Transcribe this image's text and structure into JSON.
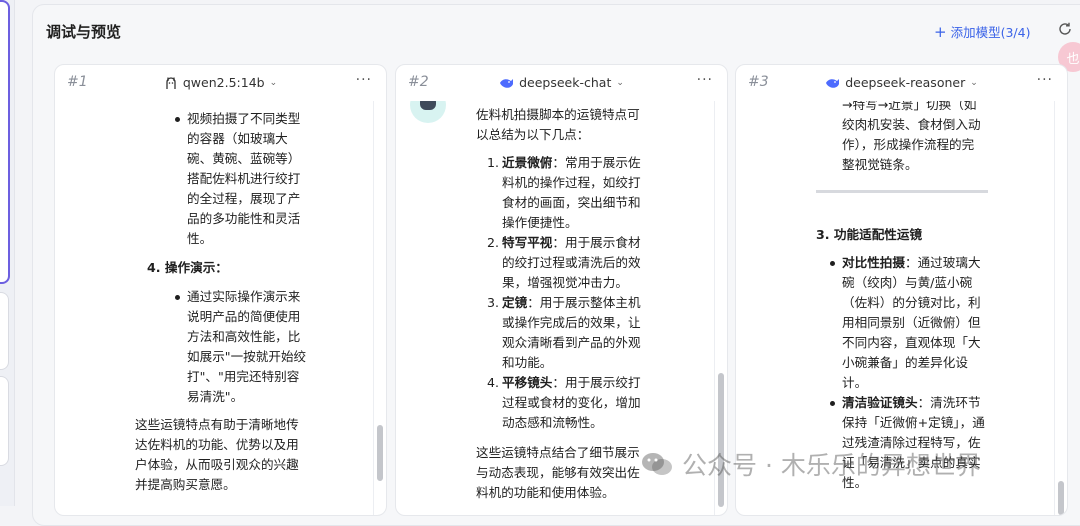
{
  "panel": {
    "title": "调试与预览",
    "add_model_label": "添加模型(3/4)"
  },
  "fab_label": "也",
  "columns": [
    {
      "index": "#1",
      "model": "qwen2.5:14b",
      "lines": [
        "视频拍摄了不同类型",
        "的容器（如玻璃大",
        "碗、黄碗、蓝碗等）",
        "搭配佐料机进行绞打",
        "的全过程，展现了产",
        "品的多功能性和灵活",
        "性。",
        "4. 操作演示：",
        "通过实际操作演示来",
        "说明产品的简便使用",
        "方法和高效性能，比",
        "如展示\"一按就开始绞",
        "打\"、\"用完还特别容",
        "易清洗\"。",
        "这些运镜特点有助于清晰地传",
        "达佐料机的功能、优势以及用",
        "户体验，从而吸引观众的兴趣",
        "并提高购买意愿。"
      ]
    },
    {
      "index": "#2",
      "model": "deepseek-chat",
      "lines": [
        "佐料机拍摄脚本的运镜特点可",
        "以总结为以下几点：",
        "1.",
        "近景微俯",
        "：常用于展示佐",
        "料机的操作过程，如绞打",
        "食材的画面，突出细节和",
        "操作便捷性。",
        "2.",
        "特写平视",
        "：用于展示食材",
        "的绞打过程或清洗后的效",
        "果，增强视觉冲击力。",
        "3.",
        "定镜",
        "：用于展示整体主机",
        "或操作完成后的效果，让",
        "观众清晰看到产品的外观",
        "和功能。",
        "4.",
        "平移镜头",
        "：用于展示绞打",
        "过程或食材的变化，增加",
        "动态感和流畅性。",
        "这些运镜特点结合了细节展示",
        "与动态表现，能够有效突出佐",
        "料机的功能和使用体验。"
      ]
    },
    {
      "index": "#3",
      "model": "deepseek-reasoner",
      "lines": [
        "→特写→近景」切换（如",
        "绞肉机安装、食材倒入动",
        "作），形成操作流程的完",
        "整视觉链条。",
        "3. 功能适配性运镜",
        "对比性拍摄",
        "：通过玻璃大",
        "碗（绞肉）与黄/蓝小碗",
        "（佐料）的分镜对比，利",
        "用相同景别（近微俯）但",
        "不同内容，直观体现「大",
        "小碗兼备」的差异化设",
        "计。",
        "清洁验证镜头",
        "：清洗环节",
        "保持「近微俯+定镜」，通",
        "过残渣清除过程特写，佐",
        "证「易清洗」卖点的真实",
        "性。"
      ]
    }
  ],
  "watermark": "公众号 · 木乐乐的异想世界"
}
